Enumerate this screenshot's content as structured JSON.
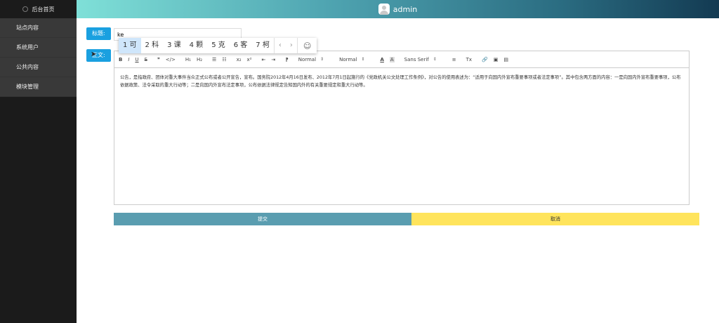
{
  "sidebar": {
    "title": "后台首页",
    "items": [
      {
        "label": "站点内容"
      },
      {
        "label": "系统用户"
      },
      {
        "label": "公共内容"
      },
      {
        "label": "模块管理"
      }
    ]
  },
  "header": {
    "user": "admin"
  },
  "form": {
    "title_label": "标题:",
    "title_value": "ke",
    "content_label": "正文:",
    "submit_label": "提交",
    "cancel_label": "取消"
  },
  "ime": {
    "candidates": [
      "1 可",
      "2 科",
      "3 课",
      "4 颗",
      "5 克",
      "6 客",
      "7 柯"
    ],
    "prev": "‹",
    "next": "›",
    "emoji": "☺"
  },
  "toolbar": {
    "bold": "B",
    "italic": "I",
    "underline": "U",
    "strike": "S",
    "quote": "❞",
    "code": "</>",
    "h1": "H₁",
    "h2": "H₂",
    "ol": "☰",
    "ul": "☷",
    "sub": "x₂",
    "sup": "x²",
    "indent_out": "⇤",
    "indent_in": "⇥",
    "direction": "⁋",
    "size": "Normal",
    "header": "Normal",
    "font": "Sans Serif",
    "color": "A",
    "background": "A",
    "align": "≡",
    "clean": "Tx",
    "link": "🔗",
    "image": "▣",
    "video": "▤"
  },
  "editor": {
    "content": "公告，是指政府、团体对重大事件当众正式公布或者公开宣告，宣布。国务院2012年4月16日发布、2012年7月1日起施行的《党政机关公文处理工作条例》，对公告的使用表述为：“适用于向国内外宣布重要事项或者法定事项”。其中包含两方面的内容：一是向国内外宣布重要事项，公布依据政策、法令采取的重大行动等；二是向国内外宣布法定事项，公布依据法律规定告知国内外的有关重要规定和重大行动等。"
  }
}
